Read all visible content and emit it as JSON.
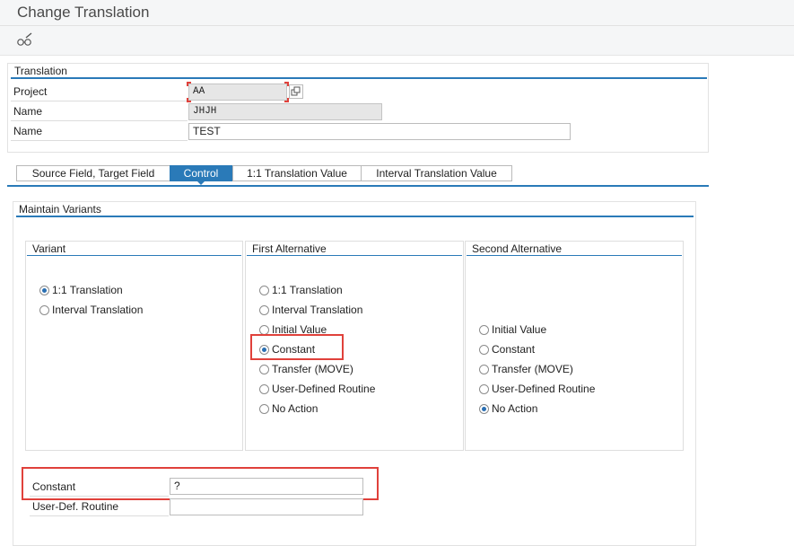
{
  "window": {
    "title": "Change Translation"
  },
  "toolbar": {
    "display_change_icon": "glasses-pencil-icon"
  },
  "translation": {
    "group_title": "Translation",
    "rows": [
      {
        "label": "Project",
        "value": "AA"
      },
      {
        "label": "Name",
        "value": "JHJH"
      },
      {
        "label": "Name",
        "value": "TEST"
      }
    ]
  },
  "tabs": [
    {
      "label": "Source Field, Target Field",
      "active": false
    },
    {
      "label": "Control",
      "active": true
    },
    {
      "label": "1:1 Translation Value",
      "active": false
    },
    {
      "label": "Interval Translation Value",
      "active": false
    }
  ],
  "maintain_variants": {
    "title": "Maintain Variants",
    "variant": {
      "title": "Variant",
      "options": [
        {
          "label": "1:1 Translation",
          "selected": true
        },
        {
          "label": "Interval Translation",
          "selected": false
        }
      ]
    },
    "first_alternative": {
      "title": "First Alternative",
      "options": [
        {
          "label": "1:1 Translation",
          "selected": false
        },
        {
          "label": "Interval Translation",
          "selected": false
        },
        {
          "label": "Initial Value",
          "selected": false
        },
        {
          "label": "Constant",
          "selected": true
        },
        {
          "label": "Transfer (MOVE)",
          "selected": false
        },
        {
          "label": "User-Defined Routine",
          "selected": false
        },
        {
          "label": "No Action",
          "selected": false
        }
      ]
    },
    "second_alternative": {
      "title": "Second Alternative",
      "options": [
        {
          "label": "Initial Value",
          "selected": false
        },
        {
          "label": "Constant",
          "selected": false
        },
        {
          "label": "Transfer (MOVE)",
          "selected": false
        },
        {
          "label": "User-Defined Routine",
          "selected": false
        },
        {
          "label": "No Action",
          "selected": true
        }
      ]
    },
    "fields": [
      {
        "label": "Constant",
        "value": "?"
      },
      {
        "label": "User-Def. Routine",
        "value": ""
      }
    ]
  },
  "colors": {
    "accent": "#2a7ab8",
    "highlight": "#e0413b"
  }
}
